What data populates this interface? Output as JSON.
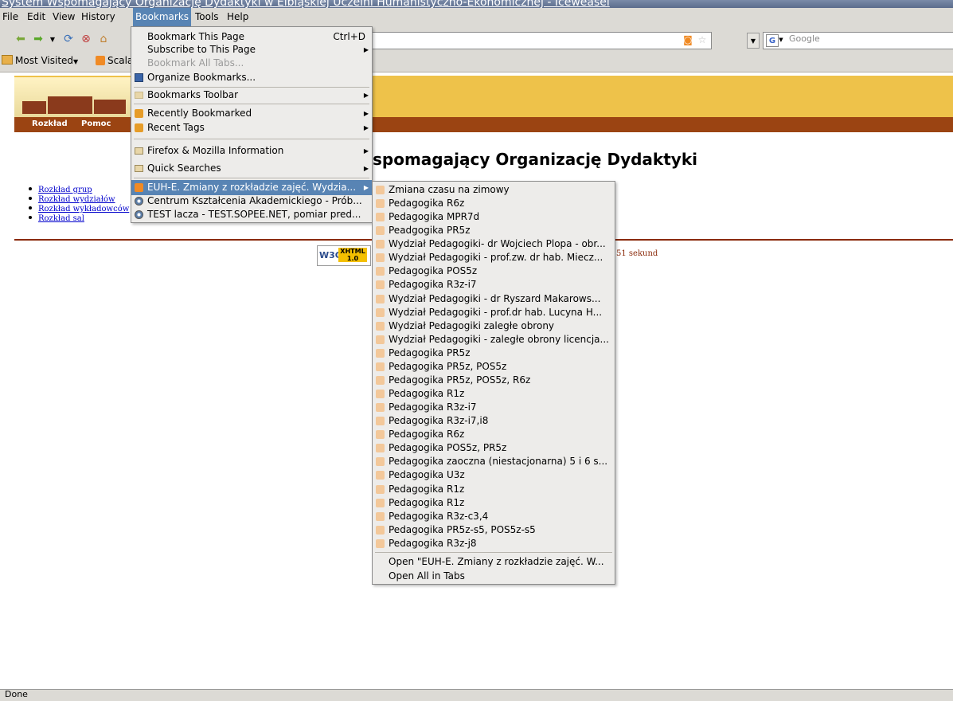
{
  "window": {
    "title": "System Wspomagający Organizację Dydaktyki w Elbląskiej Uczelni Humanistyczno-Ekonomicznej - Iceweasel"
  },
  "menubar": {
    "items": [
      "File",
      "Edit",
      "View",
      "History",
      "Bookmarks",
      "Tools",
      "Help"
    ],
    "active": "Bookmarks"
  },
  "search": {
    "engine_placeholder": "Google"
  },
  "bookmarks_toolbar": {
    "items": [
      "Most Visited",
      "Scala"
    ]
  },
  "site": {
    "nav": [
      "Rozkład",
      "Pomoc"
    ],
    "heading_visible": "spomagający Organizację Dydaktyki",
    "links": [
      "Rozkład grup",
      "Rozkład wydziałów",
      "Rozkład wykładowców",
      "Rozkład sal"
    ],
    "timing_visible": "51 sekund",
    "w3c": {
      "logo": "W3C",
      "badge": "XHTML 1.0"
    }
  },
  "bookmarks_menu": {
    "bookmark_page": "Bookmark This Page",
    "bookmark_page_shortcut": "Ctrl+D",
    "subscribe": "Subscribe to This Page",
    "bookmark_all_tabs": "Bookmark All Tabs...",
    "organize": "Organize Bookmarks...",
    "toolbar": "Bookmarks Toolbar",
    "recently_bookmarked": "Recently Bookmarked",
    "recent_tags": "Recent Tags",
    "firefox_info": "Firefox & Mozilla Information",
    "quick_searches": "Quick Searches",
    "euh_feed": "EUH-E. Zmiany z rozkładzie zajęć. Wydzia...",
    "centrum": "Centrum Kształcenia Akademickiego - Prób...",
    "test_lacza": "TEST lacza - TEST.SOPEE.NET, pomiar pred..."
  },
  "feed_submenu": {
    "items": [
      "Zmiana czasu na zimowy",
      "Pedagogika R6z",
      "Pedagogika MPR7d",
      "Peadgogika PR5z",
      "Wydział Pedagogiki- dr Wojciech Plopa - obr...",
      "Wydział Pedagogiki - prof.zw. dr hab. Miecz...",
      "Pedagogika POS5z",
      "Pedagogika R3z-i7",
      "Wydział Pedagogiki - dr Ryszard Makarows...",
      "Wydział Pedagogiki - prof.dr hab. Lucyna H...",
      "Wydział Pedagogiki zaległe obrony",
      "Wydział Pedagogiki - zaległe obrony licencja...",
      "Pedagogika PR5z",
      "Pedagogika PR5z, POS5z",
      "Pedagogika  PR5z, POS5z, R6z",
      "Pedagogika R1z",
      "Pedagogika R3z-i7",
      "Pedagogika R3z-i7,i8",
      "Pedagogika R6z",
      "Pedagogika POS5z, PR5z",
      "Pedagogika zaoczna (niestacjonarna) 5 i 6 s...",
      "Pedagogika U3z",
      "Pedagogika R1z",
      "Pedagogika R1z",
      "Pedagogika R3z-c3,4",
      "Pedagogika PR5z-s5, POS5z-s5",
      "Pedagogika R3z-j8"
    ],
    "open_feed": "Open \"EUH-E. Zmiany z rozkładzie zajęć. W...",
    "open_all_tabs": "Open All in Tabs"
  },
  "status": {
    "text": "Done"
  },
  "colors": {
    "menu_highlight": "#5884b4",
    "site_header": "#eec24a",
    "site_nav": "#9b4412",
    "feed_orange": "#f08a24"
  }
}
